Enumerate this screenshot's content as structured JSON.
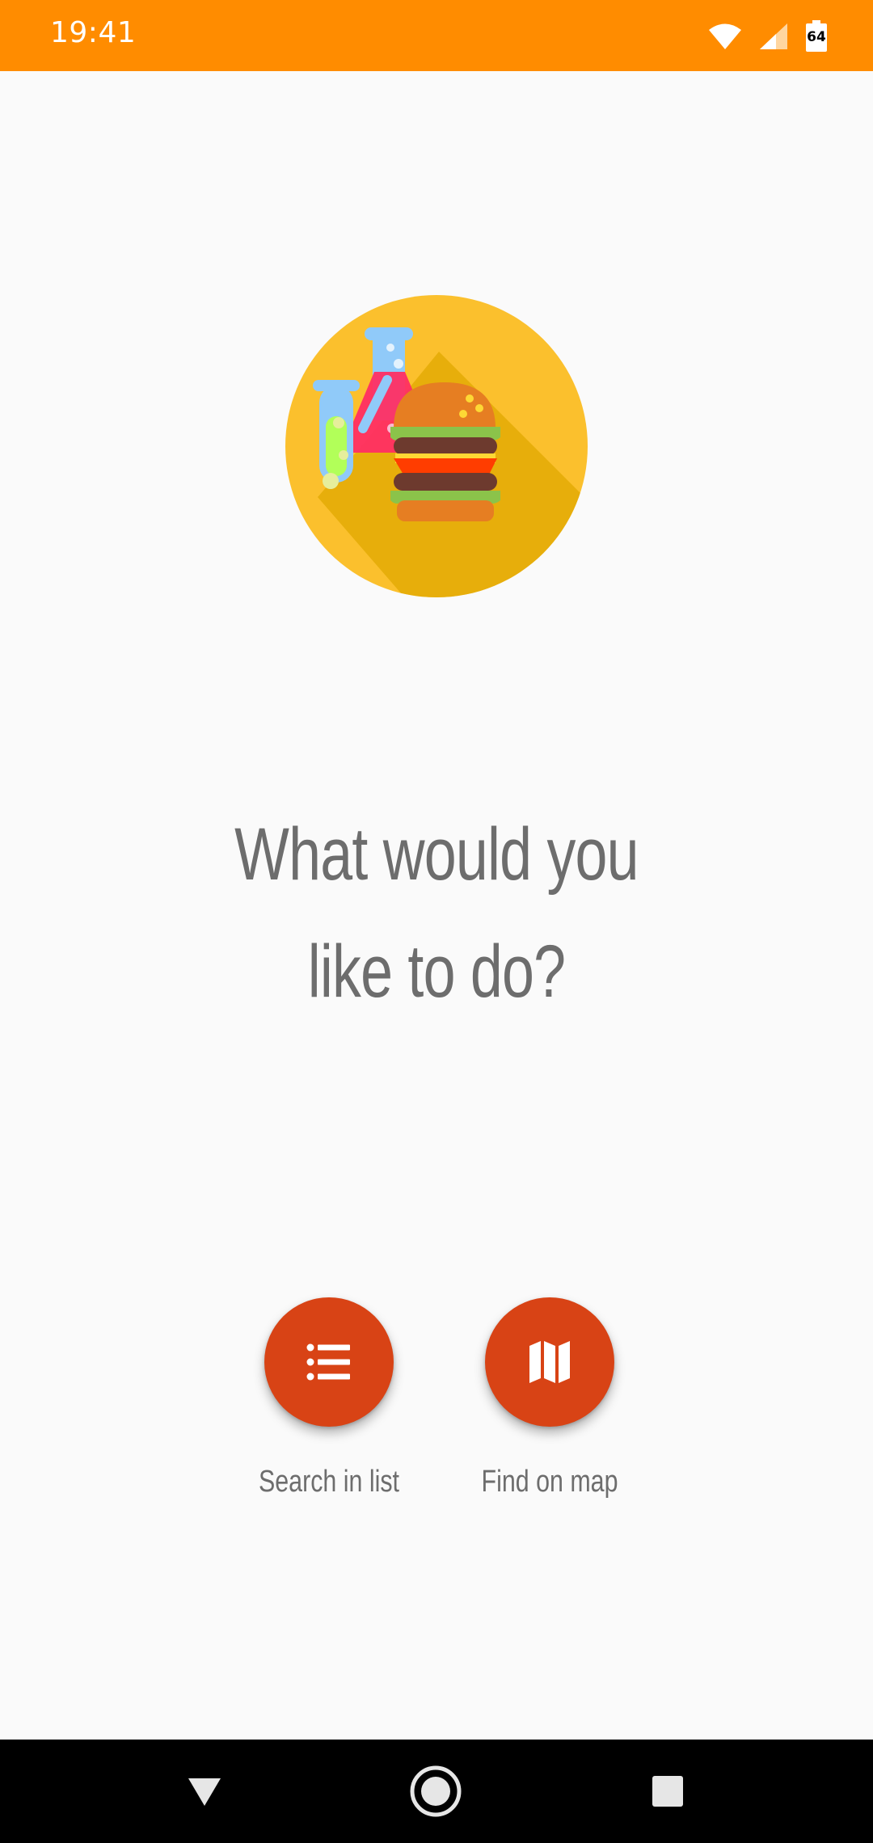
{
  "status_bar": {
    "time": "19:41",
    "battery_level": "64",
    "icons": [
      "wifi-icon",
      "cell-signal-icon",
      "battery-icon"
    ],
    "background_color": "#ff8c00"
  },
  "hero": {
    "icon": "burger-lab-logo"
  },
  "main": {
    "question_line1": "What would you",
    "question_line2": "like to do?"
  },
  "actions": [
    {
      "icon": "list-icon",
      "label": "Search in list"
    },
    {
      "icon": "map-icon",
      "label": "Find on map"
    }
  ],
  "colors": {
    "accent": "#d84315",
    "text": "#6d6d6d",
    "background": "#fafafa"
  },
  "nav_bar": {
    "buttons": [
      "back-icon",
      "home-icon",
      "recents-icon"
    ]
  }
}
